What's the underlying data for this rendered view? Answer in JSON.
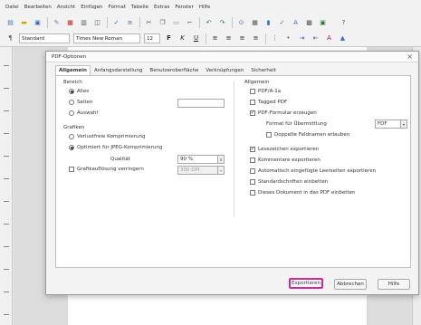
{
  "menu": [
    "Datei",
    "Bearbeiten",
    "Ansicht",
    "Einfügen",
    "Format",
    "Tabelle",
    "Extras",
    "Fenster",
    "Hilfe"
  ],
  "toolbar2": {
    "style": "Standard",
    "font": "Times New Roman",
    "size": "12"
  },
  "dialog": {
    "title": "PDF-Optionen",
    "tabs": [
      "Allgemein",
      "Anfangsdarstellung",
      "Benutzeroberfläche",
      "Verknüpfungen",
      "Sicherheit"
    ],
    "range": {
      "title": "Bereich",
      "all": "Alles",
      "pages": "Seiten",
      "selection": "Auswahl"
    },
    "images": {
      "title": "Grafiken",
      "lossless": "Verlustfreie Komprimierung",
      "jpeg": "Optimiert für JPEG-Komprimierung",
      "quality_label": "Qualität",
      "quality_value": "90 %",
      "reduce_label": "Grafikauflösung verringern",
      "resolution_value": "300 DPI"
    },
    "general": {
      "title": "Allgemein",
      "items": [
        "PDF/A-1a",
        "Tagged PDF",
        "PDF-Formular erzeugen",
        "Format für Übermittlung",
        "Doppelte Feldnamen erlauben",
        "Lesezeichen exportieren",
        "Kommentare exportieren",
        "Automatisch eingefügte Leerseiten exportieren",
        "Standardschriften einbetten",
        "Dieses Dokument in das PDF einbetten"
      ],
      "format_value": "FDF"
    },
    "buttons": {
      "export": "Exportieren",
      "cancel": "Abbrechen",
      "help": "Hilfe"
    }
  }
}
